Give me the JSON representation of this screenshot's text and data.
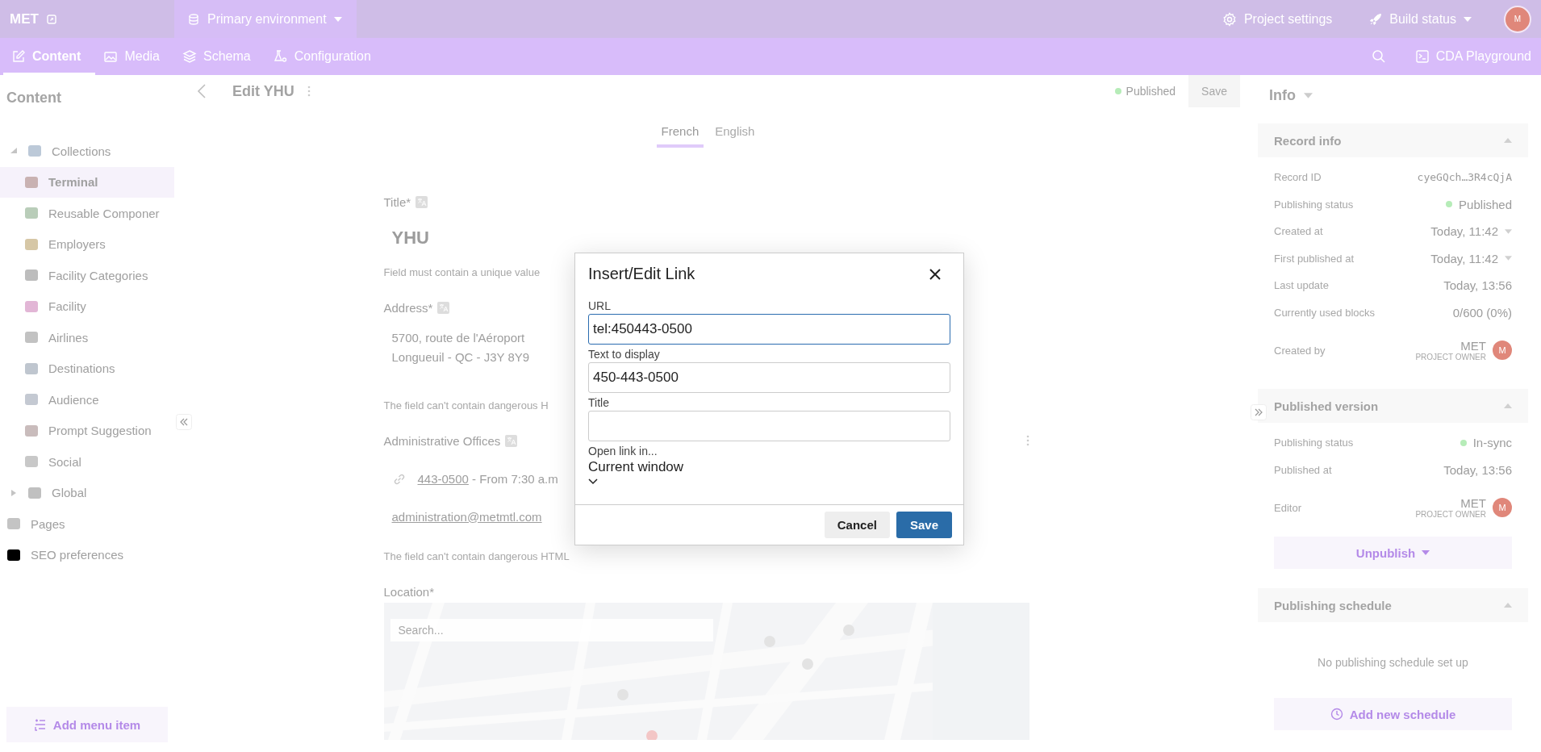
{
  "topbar": {
    "project": "MET",
    "environment": "Primary environment",
    "actions": [
      {
        "label": "Project settings",
        "kind": "settings"
      },
      {
        "label": "Build status",
        "kind": "build"
      }
    ],
    "avatar": "M"
  },
  "nav": {
    "tabs": [
      {
        "label": "Content",
        "selected": true,
        "kind": "content"
      },
      {
        "label": "Media",
        "selected": false,
        "kind": "media"
      },
      {
        "label": "Schema",
        "selected": false,
        "kind": "schema"
      },
      {
        "label": "Configuration",
        "selected": false,
        "kind": "config"
      }
    ],
    "playground": "CDA Playground"
  },
  "sidebar": {
    "title": "Content",
    "items": [
      {
        "label": "Collections",
        "kind": "folder",
        "expanded": true,
        "selected": false,
        "children": [
          {
            "label": "Terminal",
            "selected": true
          },
          {
            "label": "Reusable Componer",
            "selected": false
          },
          {
            "label": "Employers",
            "selected": false
          },
          {
            "label": "Facility Categories",
            "selected": false
          },
          {
            "label": "Facility",
            "selected": false
          },
          {
            "label": "Airlines",
            "selected": false
          },
          {
            "label": "Destinations",
            "selected": false
          },
          {
            "label": "Audience",
            "selected": false
          },
          {
            "label": "Prompt Suggestion",
            "selected": false
          },
          {
            "label": "Social",
            "selected": false
          }
        ]
      },
      {
        "label": "Global",
        "kind": "folder",
        "expanded": false,
        "selected": false
      },
      {
        "label": "Pages",
        "kind": "page",
        "selected": false
      },
      {
        "label": "SEO preferences",
        "kind": "page",
        "selected": false
      }
    ],
    "add_button": "Add menu item"
  },
  "editor": {
    "title": "Edit YHU",
    "status": "Published",
    "save": "Save",
    "save_disabled": true,
    "locales": [
      {
        "label": "French",
        "selected": true
      },
      {
        "label": "English",
        "selected": false
      }
    ],
    "fields": [
      {
        "kind": "title",
        "label": "Title*",
        "localized": true,
        "value": "YHU",
        "hint": "Field must contain a unique value"
      },
      {
        "kind": "richtext",
        "label": "Address*",
        "localized": true,
        "lines": [
          "5700, route de l'Aéroport",
          "Longueuil - QC - J3Y 8Y9"
        ],
        "hint": "The field can't contain dangerous H"
      },
      {
        "kind": "links",
        "label": "Administrative Offices",
        "localized": true,
        "link": "443-0500",
        "after": " - From 7:30 a.m",
        "email": "administration@metmtl.com",
        "hint": "The field can't contain dangerous HTML"
      },
      {
        "kind": "map",
        "label": "Location*",
        "localized": false,
        "search_placeholder": "Search..."
      }
    ]
  },
  "info": {
    "title": "Info",
    "sections": [
      {
        "title": "Record info",
        "expanded": true,
        "rows": [
          {
            "label": "Record ID",
            "value": "cyeGQch…3R4cQjA",
            "kind": "mono"
          },
          {
            "label": "Publishing status",
            "value": "Published",
            "kind": "status"
          },
          {
            "label": "Created at",
            "value": "Today, 11:42",
            "kind": "date"
          },
          {
            "label": "First published at",
            "value": "Today, 11:42",
            "kind": "date"
          },
          {
            "label": "Last update",
            "value": "Today, 13:56",
            "kind": "text"
          },
          {
            "label": "Currently used blocks",
            "value": "0/600 (0%)",
            "kind": "text"
          },
          {
            "label": "Created by",
            "value": "MET",
            "role": "PROJECT OWNER",
            "avatar": "M",
            "kind": "user"
          }
        ]
      },
      {
        "title": "Published version",
        "expanded": true,
        "rows": [
          {
            "label": "Publishing status",
            "value": "In-sync",
            "kind": "status"
          },
          {
            "label": "Published at",
            "value": "Today, 13:56",
            "kind": "text"
          },
          {
            "label": "Editor",
            "value": "MET",
            "role": "PROJECT OWNER",
            "avatar": "M",
            "kind": "user"
          }
        ],
        "button": "Unpublish"
      },
      {
        "title": "Publishing schedule",
        "expanded": true,
        "empty": "No publishing schedule set up",
        "button": "Add new schedule"
      }
    ]
  },
  "dialog": {
    "title": "Insert/Edit Link",
    "fields": [
      {
        "label": "URL",
        "value": "tel:450443-0500",
        "focused": true
      },
      {
        "label": "Text to display",
        "value": "450-443-0500",
        "focused": false
      },
      {
        "label": "Title",
        "focused": false
      }
    ],
    "target": {
      "label": "Open link in...",
      "value": "Current window"
    },
    "buttons": [
      {
        "label": "Cancel",
        "kind": "secondary"
      },
      {
        "label": "Save",
        "kind": "primary"
      }
    ]
  }
}
